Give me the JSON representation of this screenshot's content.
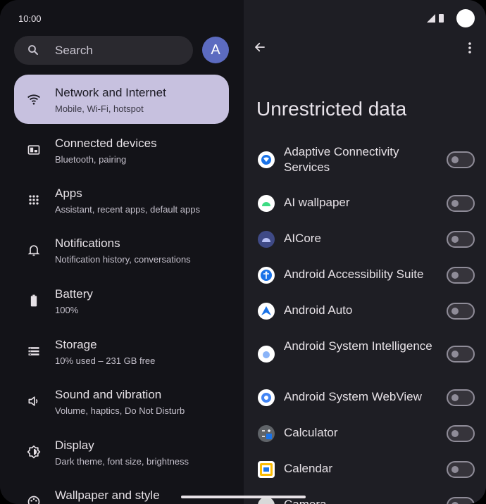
{
  "status": {
    "time": "10:00"
  },
  "search": {
    "placeholder": "Search"
  },
  "account": {
    "avatar_letter": "A"
  },
  "nav": [
    {
      "title": "Network and Internet",
      "subtitle": "Mobile, Wi-Fi, hotspot",
      "icon": "wifi-icon",
      "active": true
    },
    {
      "title": "Connected devices",
      "subtitle": "Bluetooth, pairing",
      "icon": "devices-icon"
    },
    {
      "title": "Apps",
      "subtitle": "Assistant, recent apps, default apps",
      "icon": "apps-grid-icon"
    },
    {
      "title": "Notifications",
      "subtitle": "Notification history, conversations",
      "icon": "bell-icon"
    },
    {
      "title": "Battery",
      "subtitle": "100%",
      "icon": "battery-icon"
    },
    {
      "title": "Storage",
      "subtitle": "10% used – 231 GB free",
      "icon": "storage-icon"
    },
    {
      "title": "Sound and vibration",
      "subtitle": "Volume, haptics, Do Not Disturb",
      "icon": "sound-icon"
    },
    {
      "title": "Display",
      "subtitle": "Dark theme, font size, brightness",
      "icon": "display-icon"
    },
    {
      "title": "Wallpaper and style",
      "subtitle": "",
      "icon": "palette-icon"
    }
  ],
  "detail": {
    "title": "Unrestricted data",
    "apps": [
      {
        "name": "Adaptive Connectivity Services",
        "icon": "adaptive-connectivity-icon",
        "enabled": false
      },
      {
        "name": "AI wallpaper",
        "icon": "ai-wallpaper-icon",
        "enabled": false
      },
      {
        "name": "AICore",
        "icon": "aicore-icon",
        "enabled": false
      },
      {
        "name": "Android Accessibility Suite",
        "icon": "accessibility-icon",
        "enabled": false
      },
      {
        "name": "Android Auto",
        "icon": "android-auto-icon",
        "enabled": false
      },
      {
        "name": "Android System Intelligence",
        "icon": "system-intelligence-icon",
        "enabled": false
      },
      {
        "name": "Android System WebView",
        "icon": "webview-icon",
        "enabled": false
      },
      {
        "name": "Calculator",
        "icon": "calculator-icon",
        "enabled": false
      },
      {
        "name": "Calendar",
        "icon": "calendar-icon",
        "enabled": false
      },
      {
        "name": "Camera",
        "icon": "camera-icon",
        "enabled": false
      }
    ]
  },
  "colors": {
    "active_nav_bg": "#c7c1df",
    "avatar_bg": "#5c6bc0",
    "left_bg": "#131318",
    "right_bg": "#1e1e24"
  }
}
